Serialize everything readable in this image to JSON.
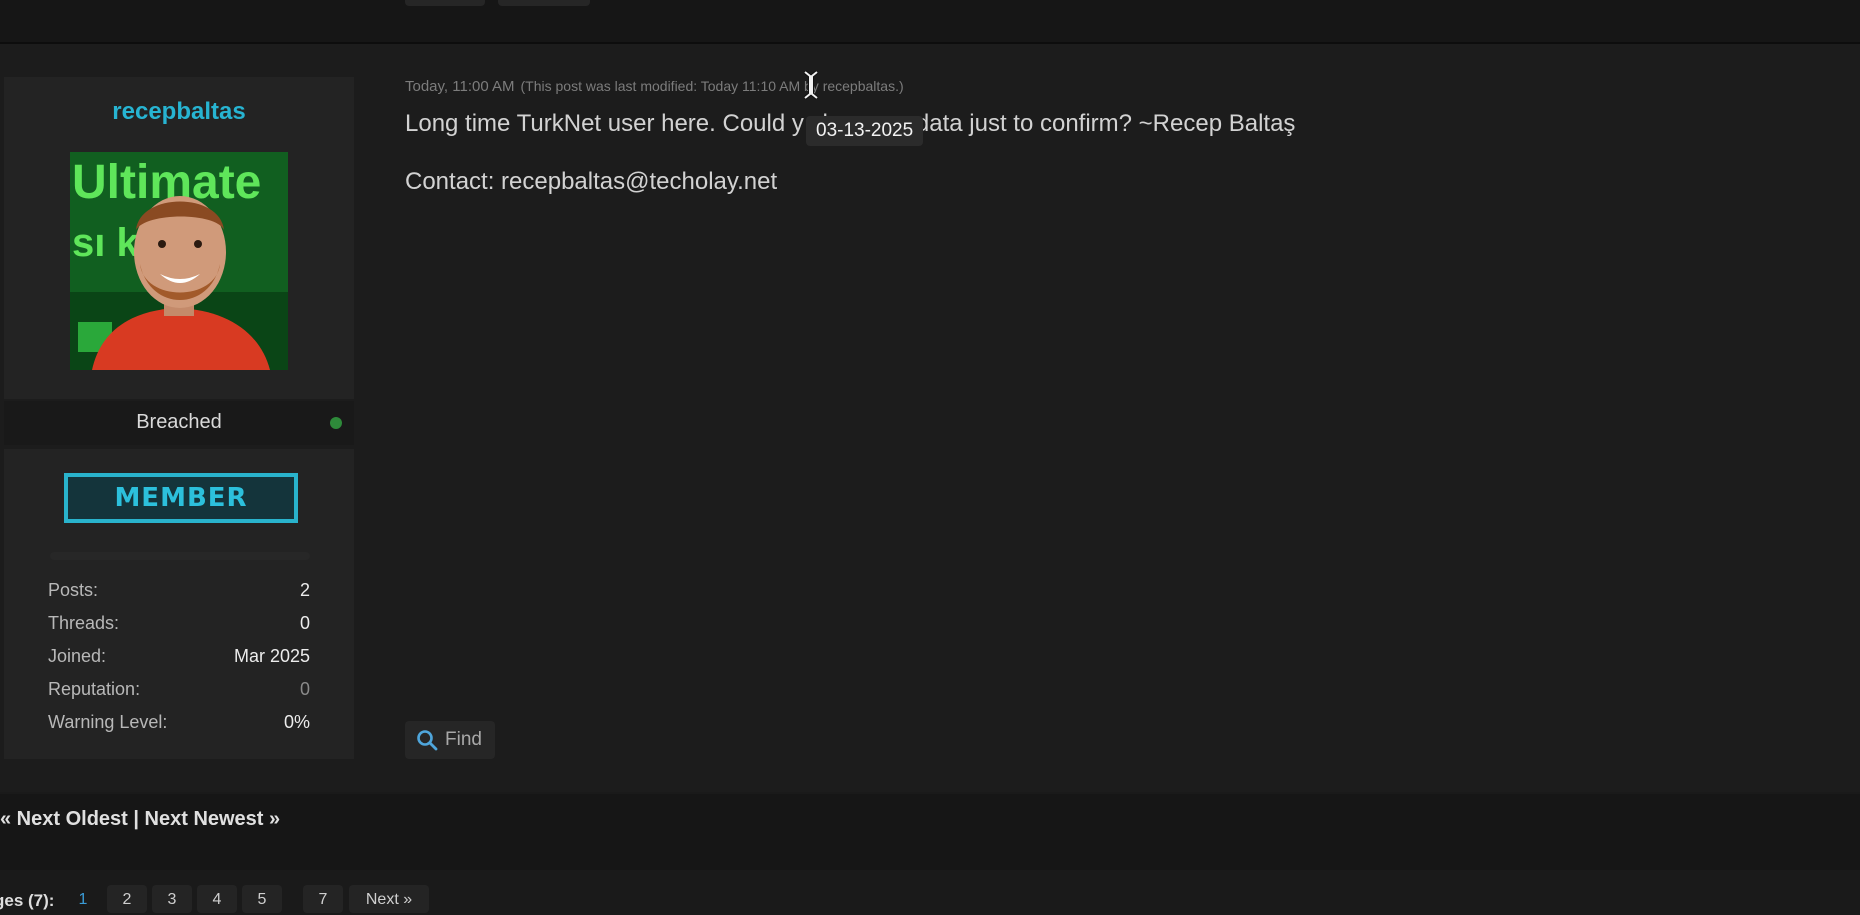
{
  "post": {
    "author": {
      "username": "recepbaltas",
      "avatar_alt": "user avatar",
      "avatar_text_top": "Ultimate",
      "avatar_text_mid": "sı k  l at",
      "status": "Breached",
      "rank": "MEMBER",
      "stats": [
        {
          "label": "Posts:",
          "value": "2"
        },
        {
          "label": "Threads:",
          "value": "0"
        },
        {
          "label": "Joined:",
          "value": "Mar 2025"
        },
        {
          "label": "Reputation:",
          "value": "0"
        },
        {
          "label": "Warning Level:",
          "value": "0%"
        }
      ]
    },
    "date": "Today, 11:00 AM",
    "edit_note": "(This post was last modified: Today 11:10 AM by recepbaltas.)",
    "body_line1": "Long time TurkNet user here. Could y          share my data just to confirm? ~Recep Baltaş",
    "body_line2": "Contact: recepbaltas@techolay.net",
    "tooltip": "03-13-2025",
    "find_label": "Find"
  },
  "thread_nav": "« Next Oldest | Next Newest »",
  "pagination": {
    "label": "ges (7):",
    "pages": [
      "1",
      "2",
      "3",
      "4",
      "5",
      "7"
    ],
    "current": "1",
    "next_label": "Next »"
  },
  "colors": {
    "background": "#1a1a1a",
    "username": "#27b4d2",
    "rank_badge": "#29b3cc",
    "online": "#2e8a3a",
    "current_page": "#3a9bd6"
  },
  "icons": {
    "find": "magnifier-icon",
    "online": "online-dot-icon",
    "cursor": "text-cursor-icon"
  }
}
